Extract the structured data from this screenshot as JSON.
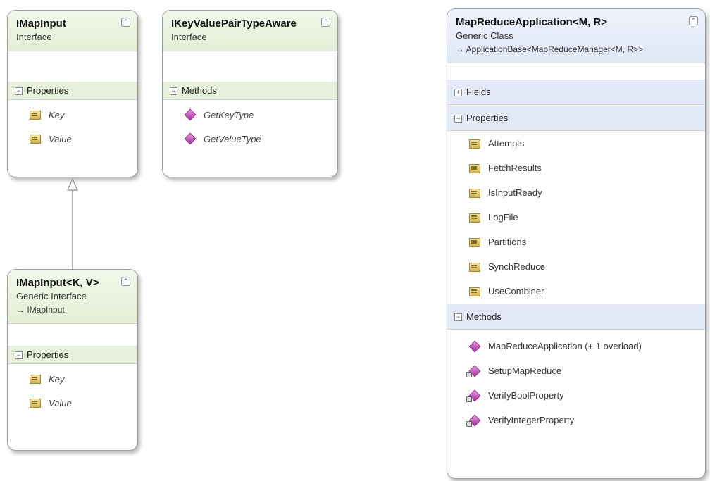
{
  "diagram": {
    "shapes": [
      {
        "name": "IMapInput",
        "kind": "Interface",
        "groups": [
          {
            "label": "Properties",
            "items": [
              "Key",
              "Value"
            ]
          }
        ]
      },
      {
        "name": "IKeyValuePairTypeAware",
        "kind": "Interface",
        "groups": [
          {
            "label": "Methods",
            "items": [
              "GetKeyType",
              "GetValueType"
            ]
          }
        ]
      },
      {
        "name": "IMapInput<K, V>",
        "kind": "Generic Interface",
        "base": "→ IMapInput",
        "groups": [
          {
            "label": "Properties",
            "items": [
              "Key",
              "Value"
            ]
          }
        ]
      },
      {
        "name": "MapReduceApplication<M, R>",
        "kind": "Generic Class",
        "base": "→ ApplicationBase<MapReduceManager<M, R>>",
        "groups": [
          {
            "label": "Fields",
            "items": []
          },
          {
            "label": "Properties",
            "items": [
              "Attempts",
              "FetchResults",
              "IsInputReady",
              "LogFile",
              "Partitions",
              "SynchReduce",
              "UseCombiner"
            ]
          },
          {
            "label": "Methods",
            "items": [
              "MapReduceApplication (+ 1 overload)",
              "SetupMapReduce",
              "VerifyBoolProperty",
              "VerifyIntegerProperty"
            ]
          }
        ]
      }
    ],
    "icons": {
      "collapse": "double-chevron-up-icon",
      "expand": "plus-box-icon",
      "collapsed": "minus-box-icon"
    },
    "colors": {
      "interface_header": "#e4efd6",
      "class_header": "#dfe6f6",
      "border": "#9aa0a6"
    }
  }
}
